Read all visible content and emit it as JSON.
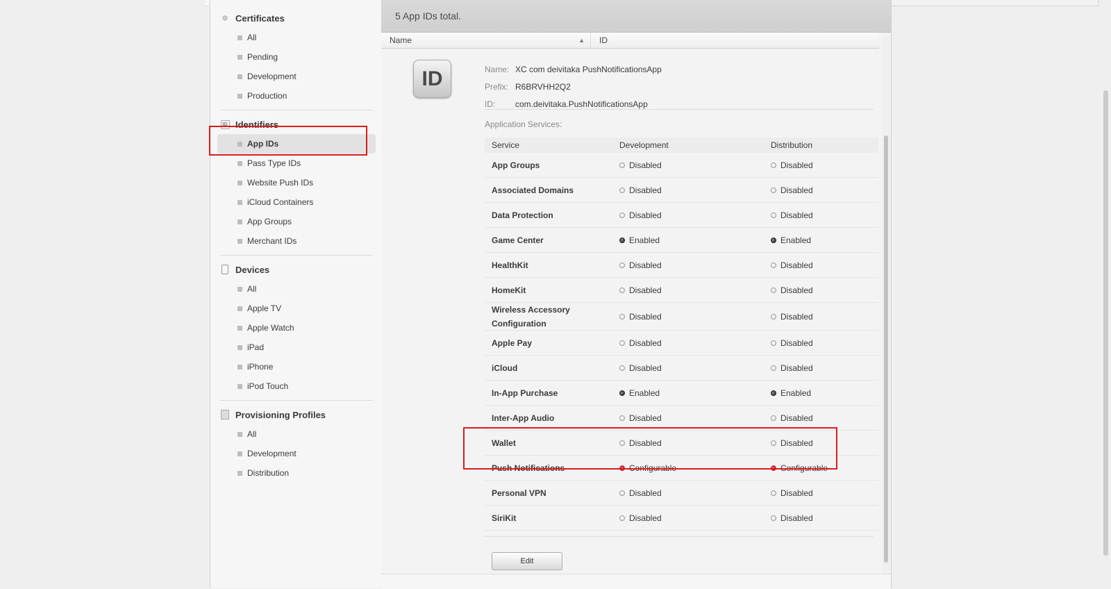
{
  "main": {
    "total_text": "5  App IDs total.",
    "columns": {
      "name": "Name",
      "id": "ID"
    },
    "app": {
      "badge": "ID",
      "name_label": "Name:",
      "name": "XC com deivitaka PushNotificationsApp",
      "prefix_label": "Prefix:",
      "prefix": "R6BRVHH2Q2",
      "id_label": "ID:",
      "id": "com.deivitaka.PushNotificationsApp"
    },
    "services_label": "Application Services:",
    "services_header": {
      "service": "Service",
      "development": "Development",
      "distribution": "Distribution"
    },
    "services": [
      {
        "name": "App Groups",
        "dev": "Disabled",
        "dist": "Disabled"
      },
      {
        "name": "Associated Domains",
        "dev": "Disabled",
        "dist": "Disabled"
      },
      {
        "name": "Data Protection",
        "dev": "Disabled",
        "dist": "Disabled"
      },
      {
        "name": "Game Center",
        "dev": "Enabled",
        "dist": "Enabled"
      },
      {
        "name": "HealthKit",
        "dev": "Disabled",
        "dist": "Disabled"
      },
      {
        "name": "HomeKit",
        "dev": "Disabled",
        "dist": "Disabled"
      },
      {
        "name": "Wireless Accessory Configuration",
        "dev": "Disabled",
        "dist": "Disabled"
      },
      {
        "name": "Apple Pay",
        "dev": "Disabled",
        "dist": "Disabled"
      },
      {
        "name": "iCloud",
        "dev": "Disabled",
        "dist": "Disabled"
      },
      {
        "name": "In-App Purchase",
        "dev": "Enabled",
        "dist": "Enabled"
      },
      {
        "name": "Inter-App Audio",
        "dev": "Disabled",
        "dist": "Disabled"
      },
      {
        "name": "Wallet",
        "dev": "Disabled",
        "dist": "Disabled"
      },
      {
        "name": "Push Notifications",
        "dev": "Configurable",
        "dist": "Configurable"
      },
      {
        "name": "Personal VPN",
        "dev": "Disabled",
        "dist": "Disabled"
      },
      {
        "name": "SiriKit",
        "dev": "Disabled",
        "dist": "Disabled"
      }
    ],
    "edit_label": "Edit"
  },
  "sidebar": {
    "certificates": {
      "title": "Certificates",
      "items": [
        "All",
        "Pending",
        "Development",
        "Production"
      ]
    },
    "identifiers": {
      "title": "Identifiers",
      "icon_text": "ID",
      "items": [
        "App IDs",
        "Pass Type IDs",
        "Website Push IDs",
        "iCloud Containers",
        "App Groups",
        "Merchant IDs"
      ]
    },
    "devices": {
      "title": "Devices",
      "items": [
        "All",
        "Apple TV",
        "Apple Watch",
        "iPad",
        "iPhone",
        "iPod Touch"
      ]
    },
    "profiles": {
      "title": "Provisioning Profiles",
      "items": [
        "All",
        "Development",
        "Distribution"
      ]
    }
  },
  "colors": {
    "highlight": "#d91c1c",
    "enabled_dot": "#222222",
    "configurable_dot": "#e0103a"
  },
  "icons": {
    "certificates": "gear-icon",
    "identifiers": "id-icon",
    "devices": "device-icon",
    "profiles": "document-icon"
  }
}
